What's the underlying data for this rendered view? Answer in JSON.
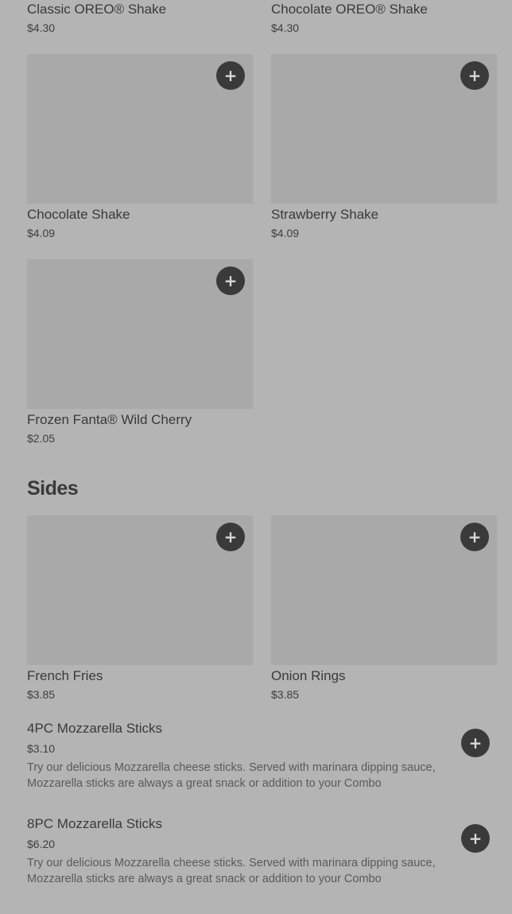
{
  "items_top": [
    {
      "name": "Classic OREO® Shake",
      "price": "$4.30"
    },
    {
      "name": "Chocolate OREO® Shake",
      "price": "$4.30"
    },
    {
      "name": "Chocolate Shake",
      "price": "$4.09"
    },
    {
      "name": "Strawberry Shake",
      "price": "$4.09"
    },
    {
      "name": "Frozen Fanta® Wild Cherry",
      "price": "$2.05"
    }
  ],
  "sides": {
    "title": "Sides",
    "cards": [
      {
        "name": "French Fries",
        "price": "$3.85"
      },
      {
        "name": "Onion Rings",
        "price": "$3.85"
      }
    ],
    "rows": [
      {
        "name": "4PC Mozzarella Sticks",
        "price": "$3.10",
        "description": "Try our delicious Mozzarella cheese sticks. Served with marinara dipping sauce, Mozzarella sticks are always a great snack or addition to your Combo"
      },
      {
        "name": "8PC Mozzarella Sticks",
        "price": "$6.20",
        "description": "Try our delicious Mozzarella cheese sticks. Served with marinara dipping sauce, Mozzarella sticks are always a great snack or addition to your Combo"
      }
    ]
  },
  "add_icon": "plus-icon",
  "add_glyph": "+",
  "colors": {
    "overlay_bg": "#b4b4b4",
    "image_placeholder": "#a9a9a9",
    "button_bg": "#3a3a3a"
  }
}
